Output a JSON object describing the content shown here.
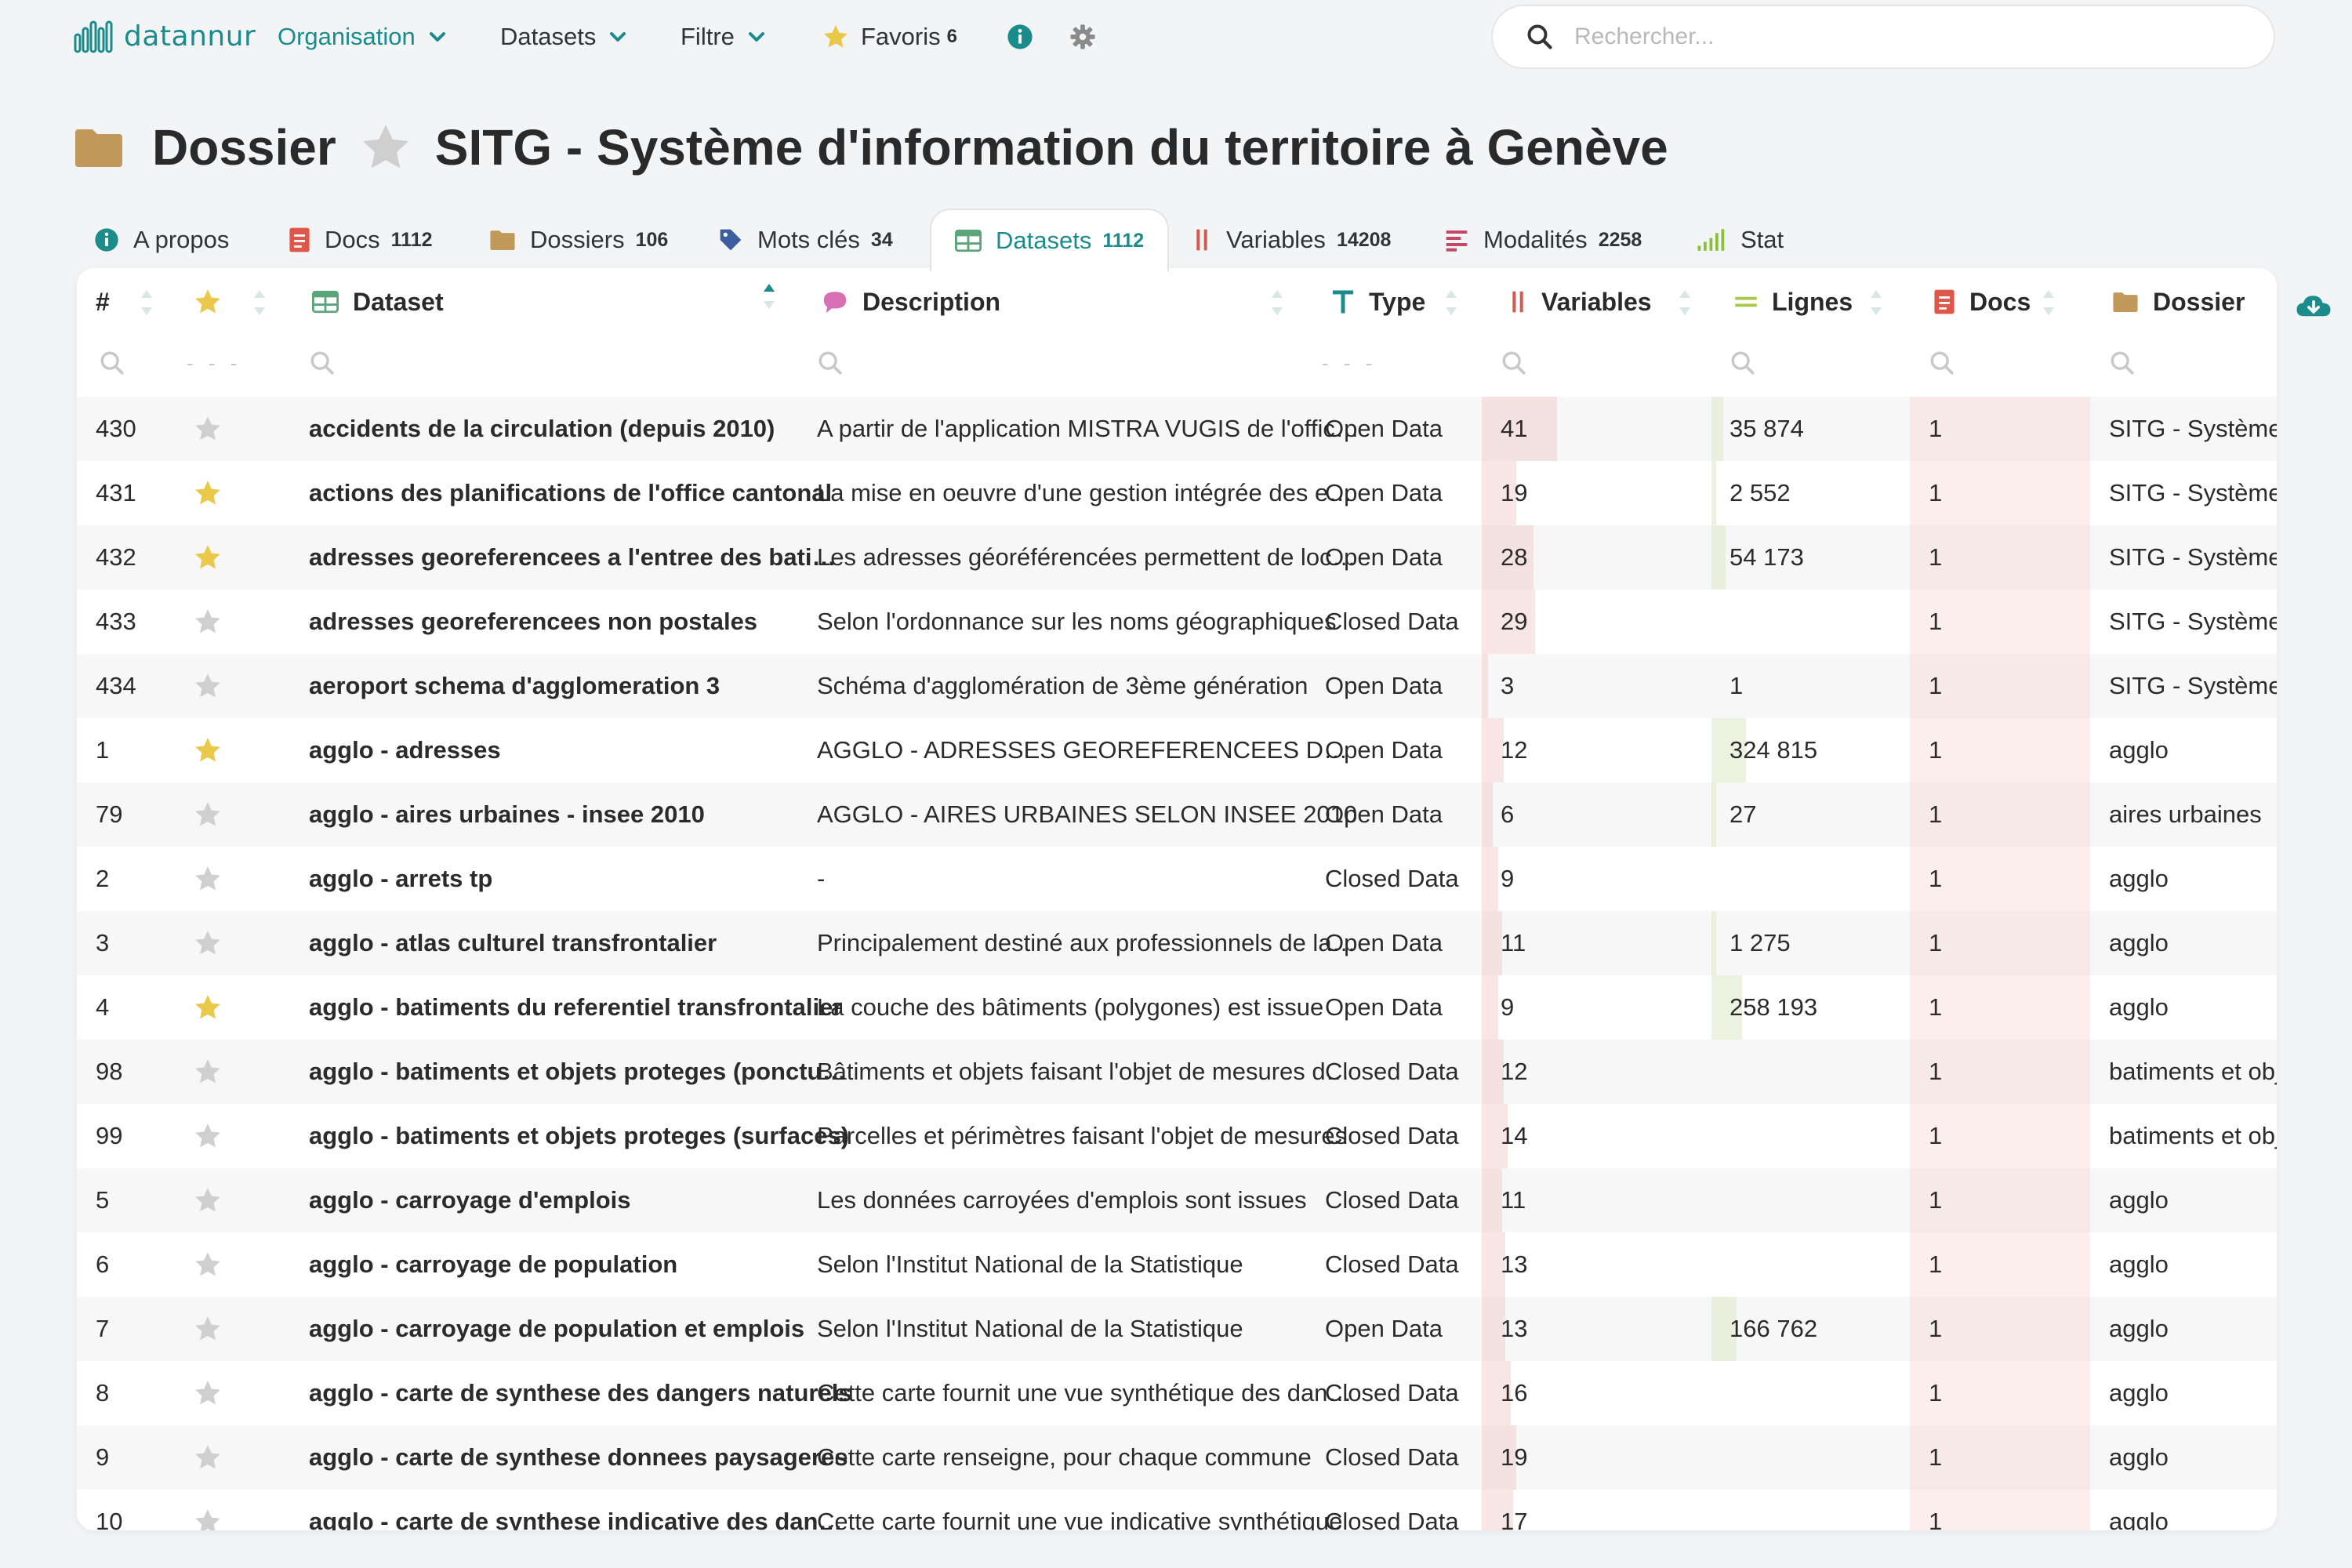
{
  "navbar": {
    "logo_text": "datannur",
    "items": [
      {
        "label": "Organisation",
        "active": true,
        "chevron": true
      },
      {
        "label": "Datasets",
        "active": false,
        "chevron": true
      },
      {
        "label": "Filtre",
        "active": false,
        "chevron": true
      }
    ],
    "favoris": {
      "label": "Favoris",
      "count": "6",
      "icon": "star-icon"
    },
    "info_icon": "info-icon",
    "settings_icon": "gear-icon",
    "search": {
      "placeholder": "Rechercher...",
      "value": ""
    }
  },
  "title": {
    "type_label": "Dossier",
    "name": "SITG - Système d'information du territoire à Genève",
    "icon": "folder-icon"
  },
  "tabs": [
    {
      "label": "A propos",
      "count": "",
      "icon": "info-icon"
    },
    {
      "label": "Docs",
      "count": "1112",
      "icon": "doc-icon"
    },
    {
      "label": "Dossiers",
      "count": "106",
      "icon": "folder-icon"
    },
    {
      "label": "Mots clés",
      "count": "34",
      "icon": "tag-icon"
    },
    {
      "label": "Datasets",
      "count": "1112",
      "icon": "table-icon",
      "active": true
    },
    {
      "label": "Variables",
      "count": "14208",
      "icon": "variables-icon"
    },
    {
      "label": "Modalités",
      "count": "2258",
      "icon": "list-icon"
    },
    {
      "label": "Stat",
      "count": "",
      "icon": "stat-icon"
    }
  ],
  "table": {
    "headers": {
      "num": "#",
      "dataset": "Dataset",
      "description": "Description",
      "type": "Type",
      "variables": "Variables",
      "lines": "Lignes",
      "docs": "Docs",
      "dossier": "Dossier"
    },
    "filter_dashes": "- - -",
    "rows": [
      {
        "num": "430",
        "fav": false,
        "name": "accidents de la circulation (depuis 2010)",
        "desc": "A partir de l'application MISTRA VUGIS de l'office cantonal",
        "type": "Open Data",
        "vars": "41",
        "lines": "35 874",
        "docs": "1",
        "dossier": "SITG - Système"
      },
      {
        "num": "431",
        "fav": true,
        "name": "actions des planifications de l'office cantonal",
        "desc": "La mise en oeuvre d'une gestion intégrée des eaux",
        "type": "Open Data",
        "vars": "19",
        "lines": "2 552",
        "docs": "1",
        "dossier": "SITG - Système"
      },
      {
        "num": "432",
        "fav": true,
        "name": "adresses georeferencees a l'entree des batiments",
        "desc": "Les adresses géoréférencées permettent de localiser",
        "type": "Open Data",
        "vars": "28",
        "lines": "54 173",
        "docs": "1",
        "dossier": "SITG - Système"
      },
      {
        "num": "433",
        "fav": false,
        "name": "adresses georeferencees non postales",
        "desc": "Selon l'ordonnance sur les noms géographiques",
        "type": "Closed Data",
        "vars": "29",
        "lines": "",
        "docs": "1",
        "dossier": "SITG - Système"
      },
      {
        "num": "434",
        "fav": false,
        "name": "aeroport schema d'agglomeration 3",
        "desc": "Schéma d'agglomération de 3ème génération",
        "type": "Open Data",
        "vars": "3",
        "lines": "1",
        "docs": "1",
        "dossier": "SITG - Système"
      },
      {
        "num": "1",
        "fav": true,
        "name": "agglo - adresses",
        "desc": "AGGLO - ADRESSES GEOREFERENCEES DU GRAND GENEVE",
        "type": "Open Data",
        "vars": "12",
        "lines": "324 815",
        "docs": "1",
        "dossier": "agglo"
      },
      {
        "num": "79",
        "fav": false,
        "name": "agglo - aires urbaines - insee 2010",
        "desc": "AGGLO - AIRES URBAINES SELON INSEE 2010",
        "type": "Open Data",
        "vars": "6",
        "lines": "27",
        "docs": "1",
        "dossier": "aires urbaines"
      },
      {
        "num": "2",
        "fav": false,
        "name": "agglo - arrets tp",
        "desc": "-",
        "type": "Closed Data",
        "vars": "9",
        "lines": "",
        "docs": "1",
        "dossier": "agglo"
      },
      {
        "num": "3",
        "fav": false,
        "name": "agglo - atlas culturel transfrontalier",
        "desc": "Principalement destiné aux professionnels de la culture",
        "type": "Open Data",
        "vars": "11",
        "lines": "1 275",
        "docs": "1",
        "dossier": "agglo"
      },
      {
        "num": "4",
        "fav": true,
        "name": "agglo - batiments du referentiel transfrontalier",
        "desc": "La couche des bâtiments (polygones) est issue",
        "type": "Open Data",
        "vars": "9",
        "lines": "258 193",
        "docs": "1",
        "dossier": "agglo"
      },
      {
        "num": "98",
        "fav": false,
        "name": "agglo - batiments et objets proteges (ponctuels)",
        "desc": "Bâtiments et objets faisant l'objet de mesures de protection",
        "type": "Closed Data",
        "vars": "12",
        "lines": "",
        "docs": "1",
        "dossier": "batiments et objets"
      },
      {
        "num": "99",
        "fav": false,
        "name": "agglo - batiments et objets proteges (surfaces)",
        "desc": "Parcelles et périmètres faisant l'objet de mesures",
        "type": "Closed Data",
        "vars": "14",
        "lines": "",
        "docs": "1",
        "dossier": "batiments et objets"
      },
      {
        "num": "5",
        "fav": false,
        "name": "agglo - carroyage d'emplois",
        "desc": "Les données carroyées d'emplois sont issues",
        "type": "Closed Data",
        "vars": "11",
        "lines": "",
        "docs": "1",
        "dossier": "agglo"
      },
      {
        "num": "6",
        "fav": false,
        "name": "agglo - carroyage de population",
        "desc": "Selon l'Institut National de la Statistique",
        "type": "Closed Data",
        "vars": "13",
        "lines": "",
        "docs": "1",
        "dossier": "agglo"
      },
      {
        "num": "7",
        "fav": false,
        "name": "agglo - carroyage de population et emplois",
        "desc": "Selon l'Institut National de la Statistique",
        "type": "Open Data",
        "vars": "13",
        "lines": "166 762",
        "docs": "1",
        "dossier": "agglo"
      },
      {
        "num": "8",
        "fav": false,
        "name": "agglo - carte de synthese des dangers naturels",
        "desc": "Cette carte fournit une vue synthétique des dangers",
        "type": "Closed Data",
        "vars": "16",
        "lines": "",
        "docs": "1",
        "dossier": "agglo"
      },
      {
        "num": "9",
        "fav": false,
        "name": "agglo - carte de synthese donnees paysageres",
        "desc": "Cette carte renseigne, pour chaque commune",
        "type": "Closed Data",
        "vars": "19",
        "lines": "",
        "docs": "1",
        "dossier": "agglo"
      },
      {
        "num": "10",
        "fav": false,
        "name": "agglo - carte de synthese indicative des dangers",
        "desc": "Cette carte fournit une vue indicative synthétique",
        "type": "Closed Data",
        "vars": "17",
        "lines": "",
        "docs": "1",
        "dossier": "agglo"
      }
    ]
  },
  "colors": {
    "accent": "#1b8b8b",
    "star_active": "#e9c84a",
    "star_inactive": "#cfcfcf",
    "folder": "#c19a5b",
    "doc_red": "#e0574a"
  }
}
